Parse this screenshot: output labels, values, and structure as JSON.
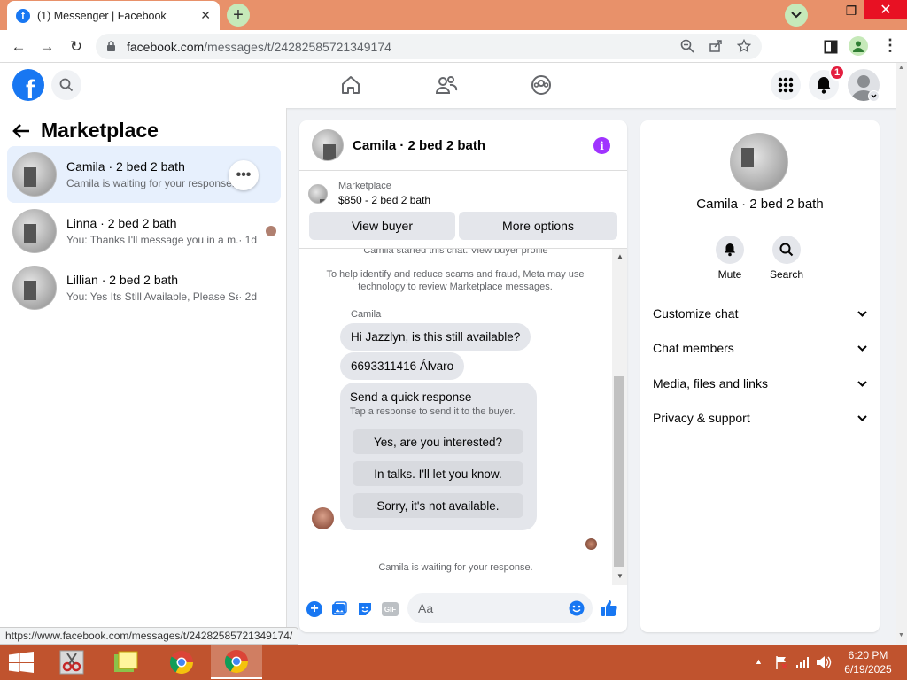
{
  "browser": {
    "tab_title": "(1) Messenger | Facebook",
    "url_host": "facebook.com",
    "url_path": "/messages/t/24282585721349174",
    "status_url": "https://www.facebook.com/messages/t/24282585721349174/"
  },
  "header": {
    "notification_count": "1"
  },
  "sidebar": {
    "title": "Marketplace",
    "conversations": [
      {
        "name": "Camila · 2 bed 2 bath",
        "preview": "Camila is waiting for your response."
      },
      {
        "name": "Linna · 2 bed 2 bath",
        "preview": "You: Thanks I'll message you in a m...",
        "time": "· 1d"
      },
      {
        "name": "Lillian · 2 bed 2 bath",
        "preview": "You: Yes Its Still Available, Please Send...",
        "time": "· 2d"
      }
    ]
  },
  "chat": {
    "header_name": "Camila · 2 bed 2 bath",
    "listing_label": "Marketplace",
    "listing_price": "$850 - 2 bed 2 bath",
    "view_buyer_label": "View buyer",
    "more_options_label": "More options",
    "started_note": "Camila started this chat. View buyer profile",
    "safety_note": "To help identify and reduce scams and fraud, Meta may use technology to review Marketplace messages.",
    "sender_name": "Camila",
    "messages": [
      "Hi Jazzlyn, is this still available?",
      "6693311416 Álvaro"
    ],
    "quick_title": "Send a quick response",
    "quick_subtitle": "Tap a response to send it to the buyer.",
    "quick_replies": [
      "Yes, are you interested?",
      "In talks. I'll let you know.",
      "Sorry, it's not available."
    ],
    "waiting_note": "Camila is waiting for your response.",
    "composer_placeholder": "Aa",
    "gif_label": "GIF"
  },
  "details": {
    "name": "Camila · 2 bed 2 bath",
    "mute_label": "Mute",
    "search_label": "Search",
    "menu": [
      "Customize chat",
      "Chat members",
      "Media, files and links",
      "Privacy & support"
    ]
  },
  "taskbar": {
    "time": "6:20 PM",
    "date": "6/19/2025"
  },
  "colors": {
    "brand": "#1877f2",
    "accent_purple": "#a033ff",
    "taskbar": "#c0532e",
    "notification": "#e41e3f"
  }
}
